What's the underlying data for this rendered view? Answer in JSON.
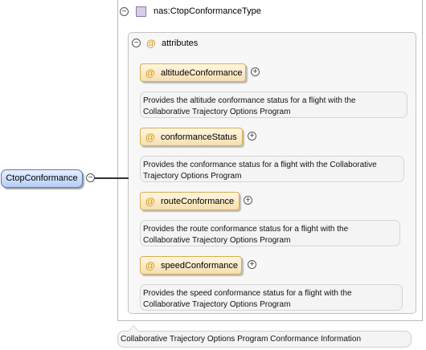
{
  "type_header": {
    "collapse_symbol": "⊖",
    "name": "nas:CtopConformanceType"
  },
  "attributes": {
    "collapse_symbol": "⊖",
    "icon": "@",
    "label": "attributes",
    "items": [
      {
        "name": "altitudeConformance",
        "expand_symbol": "+",
        "doc_line1": "Provides the altitude conformance status for a flight with the",
        "doc_line2": "Collaborative Trajectory Options Program"
      },
      {
        "name": "conformanceStatus",
        "expand_symbol": "+",
        "doc_line1": "Provides the conformance status for a flight with the Collaborative",
        "doc_line2": "Trajectory Options Program"
      },
      {
        "name": "routeConformance",
        "expand_symbol": "+",
        "doc_line1": "Provides the route conformance status for a flight with the",
        "doc_line2": "Collaborative Trajectory Options Program"
      },
      {
        "name": "speedConformance",
        "expand_symbol": "+",
        "doc_line1": "Provides the speed conformance status for a flight with the",
        "doc_line2": "Collaborative Trajectory Options Program"
      }
    ]
  },
  "root_element": {
    "name": "CtopConformance",
    "collapse_symbol": "−"
  },
  "footer": {
    "documentation": "Collaborative Trajectory Options Program Conformance Information"
  }
}
